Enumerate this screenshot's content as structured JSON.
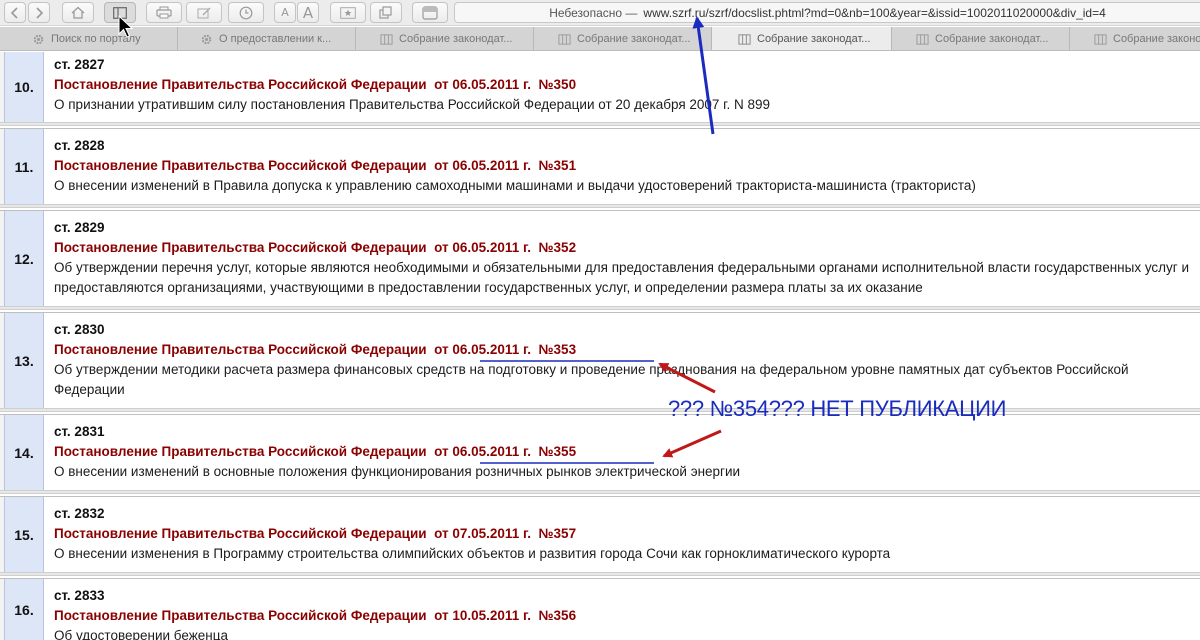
{
  "browser": {
    "url_warning": "Небезопасно —",
    "url": "www.szrf.ru/szrf/docslist.phtml?md=0&nb=100&year=&issid=1002011020000&div_id=4",
    "font_small_label": "A",
    "font_large_label": "A"
  },
  "tabs": [
    {
      "label": "Поиск по порталу",
      "icon": "gear-icon"
    },
    {
      "label": "О предоставлении к...",
      "icon": "gear-icon"
    },
    {
      "label": "Собрание законодат...",
      "icon": "columns-icon"
    },
    {
      "label": "Собрание законодат...",
      "icon": "columns-icon"
    },
    {
      "label": "Собрание законодат...",
      "icon": "columns-icon"
    },
    {
      "label": "Собрание законодат...",
      "icon": "columns-icon"
    },
    {
      "label": "Собрание законодат...",
      "icon": "columns-icon"
    }
  ],
  "documents": [
    {
      "num": "10.",
      "st": "ст. 2827",
      "title": "Постановление Правительства Российской Федерации",
      "date": "от 06.05.2011 г.",
      "number": "№350",
      "desc": "О признании утратившим силу постановления Правительства Российской Федерации от 20 декабря 2007 г. N 899"
    },
    {
      "num": "11.",
      "st": "ст. 2828",
      "title": "Постановление Правительства Российской Федерации",
      "date": "от 06.05.2011 г.",
      "number": "№351",
      "desc": "О внесении изменений в Правила допуска к управлению самоходными машинами и выдачи удостоверений тракториста-машиниста (тракториста)"
    },
    {
      "num": "12.",
      "st": "ст. 2829",
      "title": "Постановление Правительства Российской Федерации",
      "date": "от 06.05.2011 г.",
      "number": "№352",
      "desc": "Об утверждении перечня услуг, которые являются необходимыми и обязательными для предоставления федеральными органами исполнительной власти государственных услуг и предоставляются организациями, участвующими в предоставлении государственных услуг, и определении размера платы за их оказание"
    },
    {
      "num": "13.",
      "st": "ст. 2830",
      "title": "Постановление Правительства Российской Федерации",
      "date": "от 06.05.2011 г.",
      "number": "№353",
      "desc": "Об утверждении методики расчета размера финансовых средств на подготовку и проведение празднования на федеральном уровне памятных дат субъектов Российской Федерации"
    },
    {
      "num": "14.",
      "st": "ст. 2831",
      "title": "Постановление Правительства Российской Федерации",
      "date": "от 06.05.2011 г.",
      "number": "№355",
      "desc": "О внесении изменений в основные положения функционирования розничных рынков электрической энергии"
    },
    {
      "num": "15.",
      "st": "ст. 2832",
      "title": "Постановление Правительства Российской Федерации",
      "date": "от 07.05.2011 г.",
      "number": "№357",
      "desc": "О внесении изменения в Программу строительства олимпийских объектов и развития города Сочи как горноклиматического курорта"
    },
    {
      "num": "16.",
      "st": "ст. 2833",
      "title": "Постановление Правительства Российской Федерации",
      "date": "от 10.05.2011 г.",
      "number": "№356",
      "desc": "Об удостоверении беженца"
    }
  ],
  "annotation": {
    "text": "??? №354??? НЕТ ПУБЛИКАЦИИ",
    "text_color": "#1a2cc0",
    "arrow_red": "#c01818",
    "arrow_blue": "#1a2cc0",
    "underline_color": "#1a2cc0"
  },
  "colors": {
    "title_red": "#8b0000",
    "num_cell_bg": "#dde6f7"
  }
}
